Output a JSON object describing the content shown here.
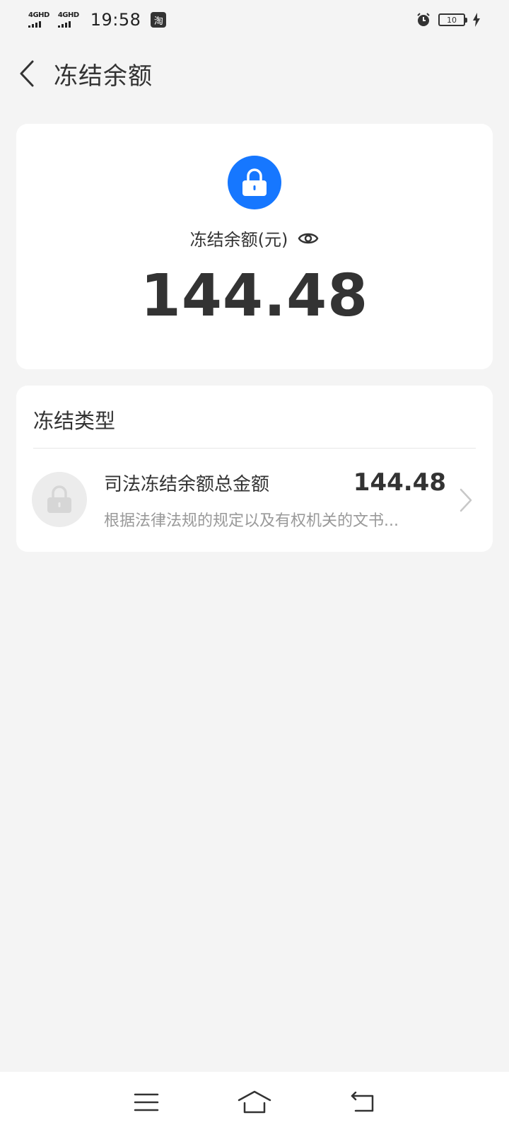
{
  "status_bar": {
    "network1": "4GHD",
    "network2": "4GHD",
    "time": "19:58",
    "app_badge": "淘",
    "battery_level": "10"
  },
  "header": {
    "title": "冻结余额"
  },
  "balance_card": {
    "label": "冻结余额(元)",
    "amount": "144.48",
    "accent_color": "#1677ff"
  },
  "types_card": {
    "section_title": "冻结类型",
    "items": [
      {
        "title": "司法冻结余额总金额",
        "amount": "144.48",
        "description": "根据法律法规的规定以及有权机关的文书..."
      }
    ]
  },
  "icons": {
    "back": "chevron-left-icon",
    "lock": "lock-icon",
    "eye": "eye-icon",
    "chevron": "chevron-right-icon",
    "menu": "menu-icon",
    "home": "home-icon",
    "return": "back-icon"
  }
}
